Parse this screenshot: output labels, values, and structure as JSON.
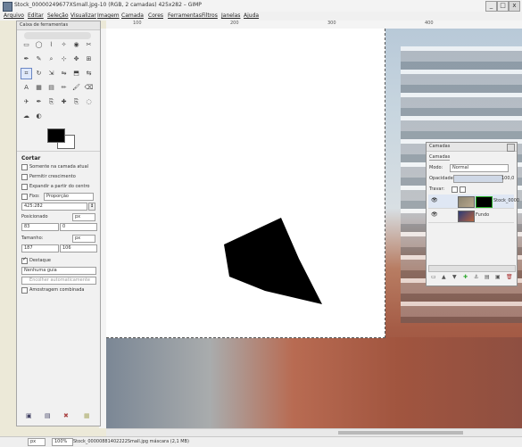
{
  "titlebar": {
    "title": "Stock_00000249677XSmall.jpg-10 (RGB, 2 camadas) 425x282 – GIMP",
    "minimize": "_",
    "maximize": "□",
    "close": "x"
  },
  "menubar": {
    "items": [
      "Arquivo",
      "Editar",
      "Seleção",
      "Visualizar",
      "Imagem",
      "Camada",
      "Cores",
      "Ferramentas",
      "Filtros",
      "Janelas",
      "Ajuda"
    ]
  },
  "ruler": {
    "top": [
      "100",
      "200",
      "300",
      "400"
    ]
  },
  "toolbox": {
    "title": "Caixa de ferramentas",
    "tools": [
      "rect-select",
      "ellipse-select",
      "free-select",
      "fuzzy-select",
      "color-select",
      "scissors",
      "paths",
      "color-picker",
      "zoom",
      "measure",
      "move",
      "align",
      "crop",
      "rotate",
      "scale",
      "shear",
      "perspective",
      "flip",
      "text",
      "bucket",
      "blend",
      "pencil",
      "paintbrush",
      "eraser",
      "airbrush",
      "ink",
      "clone",
      "heal",
      "perspective-clone",
      "blur",
      "smudge",
      "dodge"
    ],
    "options": {
      "title": "Cortar",
      "only_current_layer": "Somente na camada atual",
      "allow_growing": "Permitir crescimento",
      "expand_from_center": "Expandir a partir do centro",
      "fixed_label": "Fixo:",
      "fixed_value": "Proporção",
      "ratio_value": "425:282",
      "position_label": "Posicionado",
      "position_unit": "px",
      "pos_x": "83",
      "pos_y": "0",
      "size_label": "Tamanho:",
      "size_unit": "px",
      "size_w": "187",
      "size_h": "106",
      "highlight": "Destaque",
      "guides_value": "Nenhuma guia",
      "auto_shrink": "Encolher automaticamente",
      "sample_merged": "Amostragem combinada"
    }
  },
  "layers_panel": {
    "title": "Camadas",
    "tab": "Camadas",
    "mode_label": "Modo:",
    "mode_value": "Normal",
    "opacity_label": "Opacidade:",
    "opacity_value": "100,0",
    "lock_label": "Travar:",
    "layers": [
      {
        "name": "Stock_0000",
        "visible": true
      },
      {
        "name": "Fundo",
        "visible": true
      }
    ]
  },
  "status": {
    "unit": "px",
    "zoom": "100%",
    "message": "Stock_00000881402222Small.jpg máscara (2,1 MB)"
  }
}
